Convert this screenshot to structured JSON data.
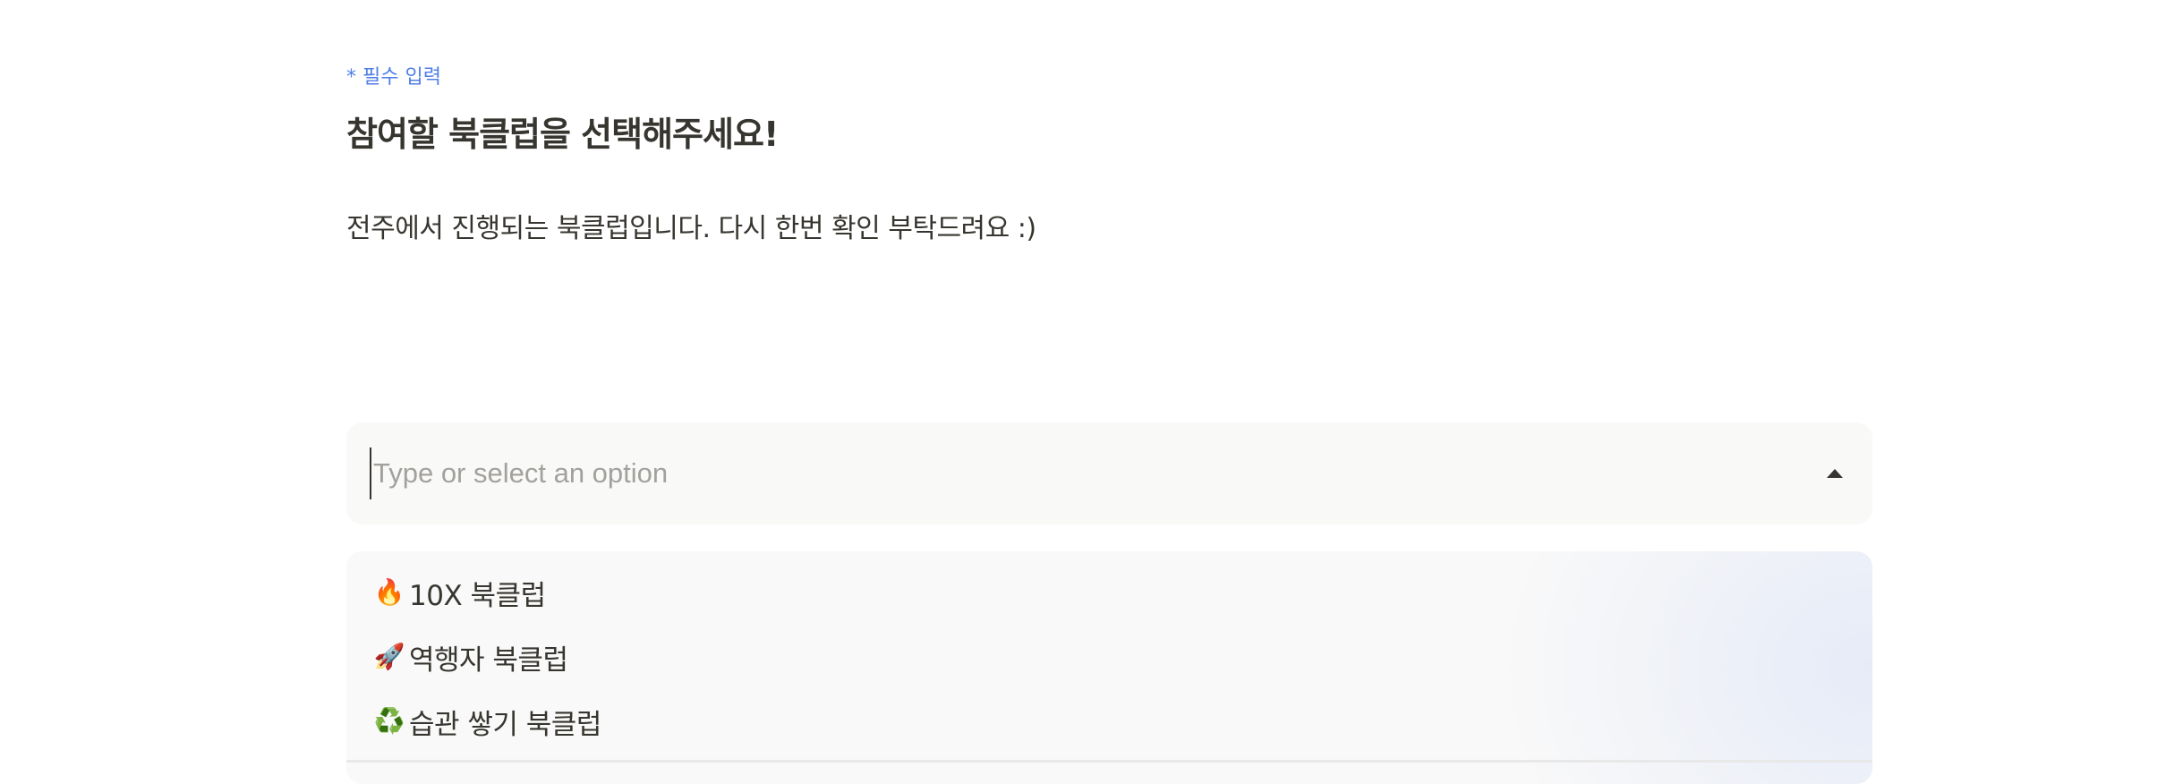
{
  "form": {
    "required_label": "* 필수 입력",
    "question_title": "참여할 북클럽을 선택해주세요!",
    "question_description": "전주에서 진행되는 북클럽입니다. 다시 한번 확인 부탁드려요 :)"
  },
  "combobox": {
    "placeholder": "Type or select an option",
    "value": "",
    "toggle_icon": "caret-up-icon",
    "expanded": true
  },
  "options": [
    {
      "icon": "fire-emoji",
      "emoji": "🔥",
      "label": "10X 북클럽"
    },
    {
      "icon": "rocket-emoji",
      "emoji": "🚀",
      "label": "역행자 북클럽"
    },
    {
      "icon": "recycle-emoji",
      "emoji": "♻️",
      "label": "습관 쌓기 북클럽"
    }
  ],
  "colors": {
    "required_accent": "#4f7ee8",
    "text": "#37352f",
    "field_background": "#f9f9f8",
    "placeholder": "#a3a19d"
  }
}
